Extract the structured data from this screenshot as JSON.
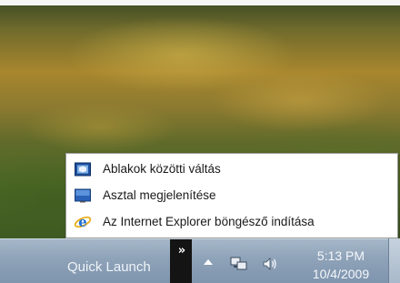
{
  "menu": {
    "items": [
      {
        "label": "Ablakok közötti váltás",
        "icon": "switch-windows-icon"
      },
      {
        "label": "Asztal megjelenítése",
        "icon": "show-desktop-icon"
      },
      {
        "label": "Az Internet Explorer böngésző indítása",
        "icon": "internet-explorer-icon"
      }
    ]
  },
  "taskbar": {
    "quick_launch_label": "Quick Launch",
    "chevron_glyph": "»",
    "tray_icons": [
      "show-hidden-icons-arrow",
      "network-icon",
      "volume-icon"
    ],
    "clock": {
      "time": "5:13 PM",
      "date": "10/4/2009"
    }
  },
  "colors": {
    "taskbar": "#8ea2b8",
    "chevron_button": "#141414",
    "popup_bg": "#ffffff"
  }
}
